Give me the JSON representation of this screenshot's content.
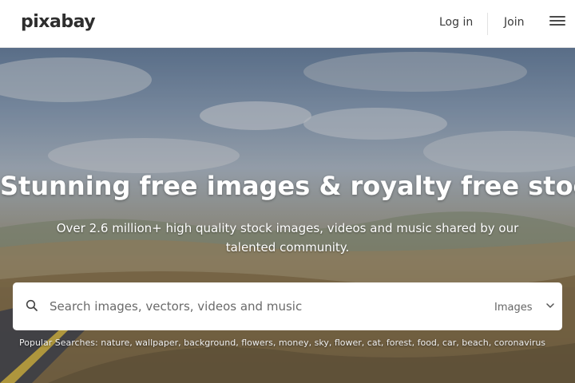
{
  "header": {
    "logo": "pixabay",
    "login": "Log in",
    "join": "Join",
    "menu_icon": "hamburger-menu-icon"
  },
  "hero": {
    "headline": "Stunning free images & royalty free stock",
    "subline": "Over 2.6 million+ high quality stock images, videos and music shared by our talented community."
  },
  "search": {
    "icon": "search-icon",
    "placeholder": "Search images, vectors, videos and music",
    "value": "",
    "type_selected": "Images",
    "type_icon": "chevron-down-icon"
  },
  "popular": {
    "label": "Popular Searches:",
    "terms": [
      "nature",
      "wallpaper",
      "background",
      "flowers",
      "money",
      "sky",
      "flower",
      "cat",
      "forest",
      "food",
      "car",
      "beach",
      "coronavirus"
    ]
  }
}
